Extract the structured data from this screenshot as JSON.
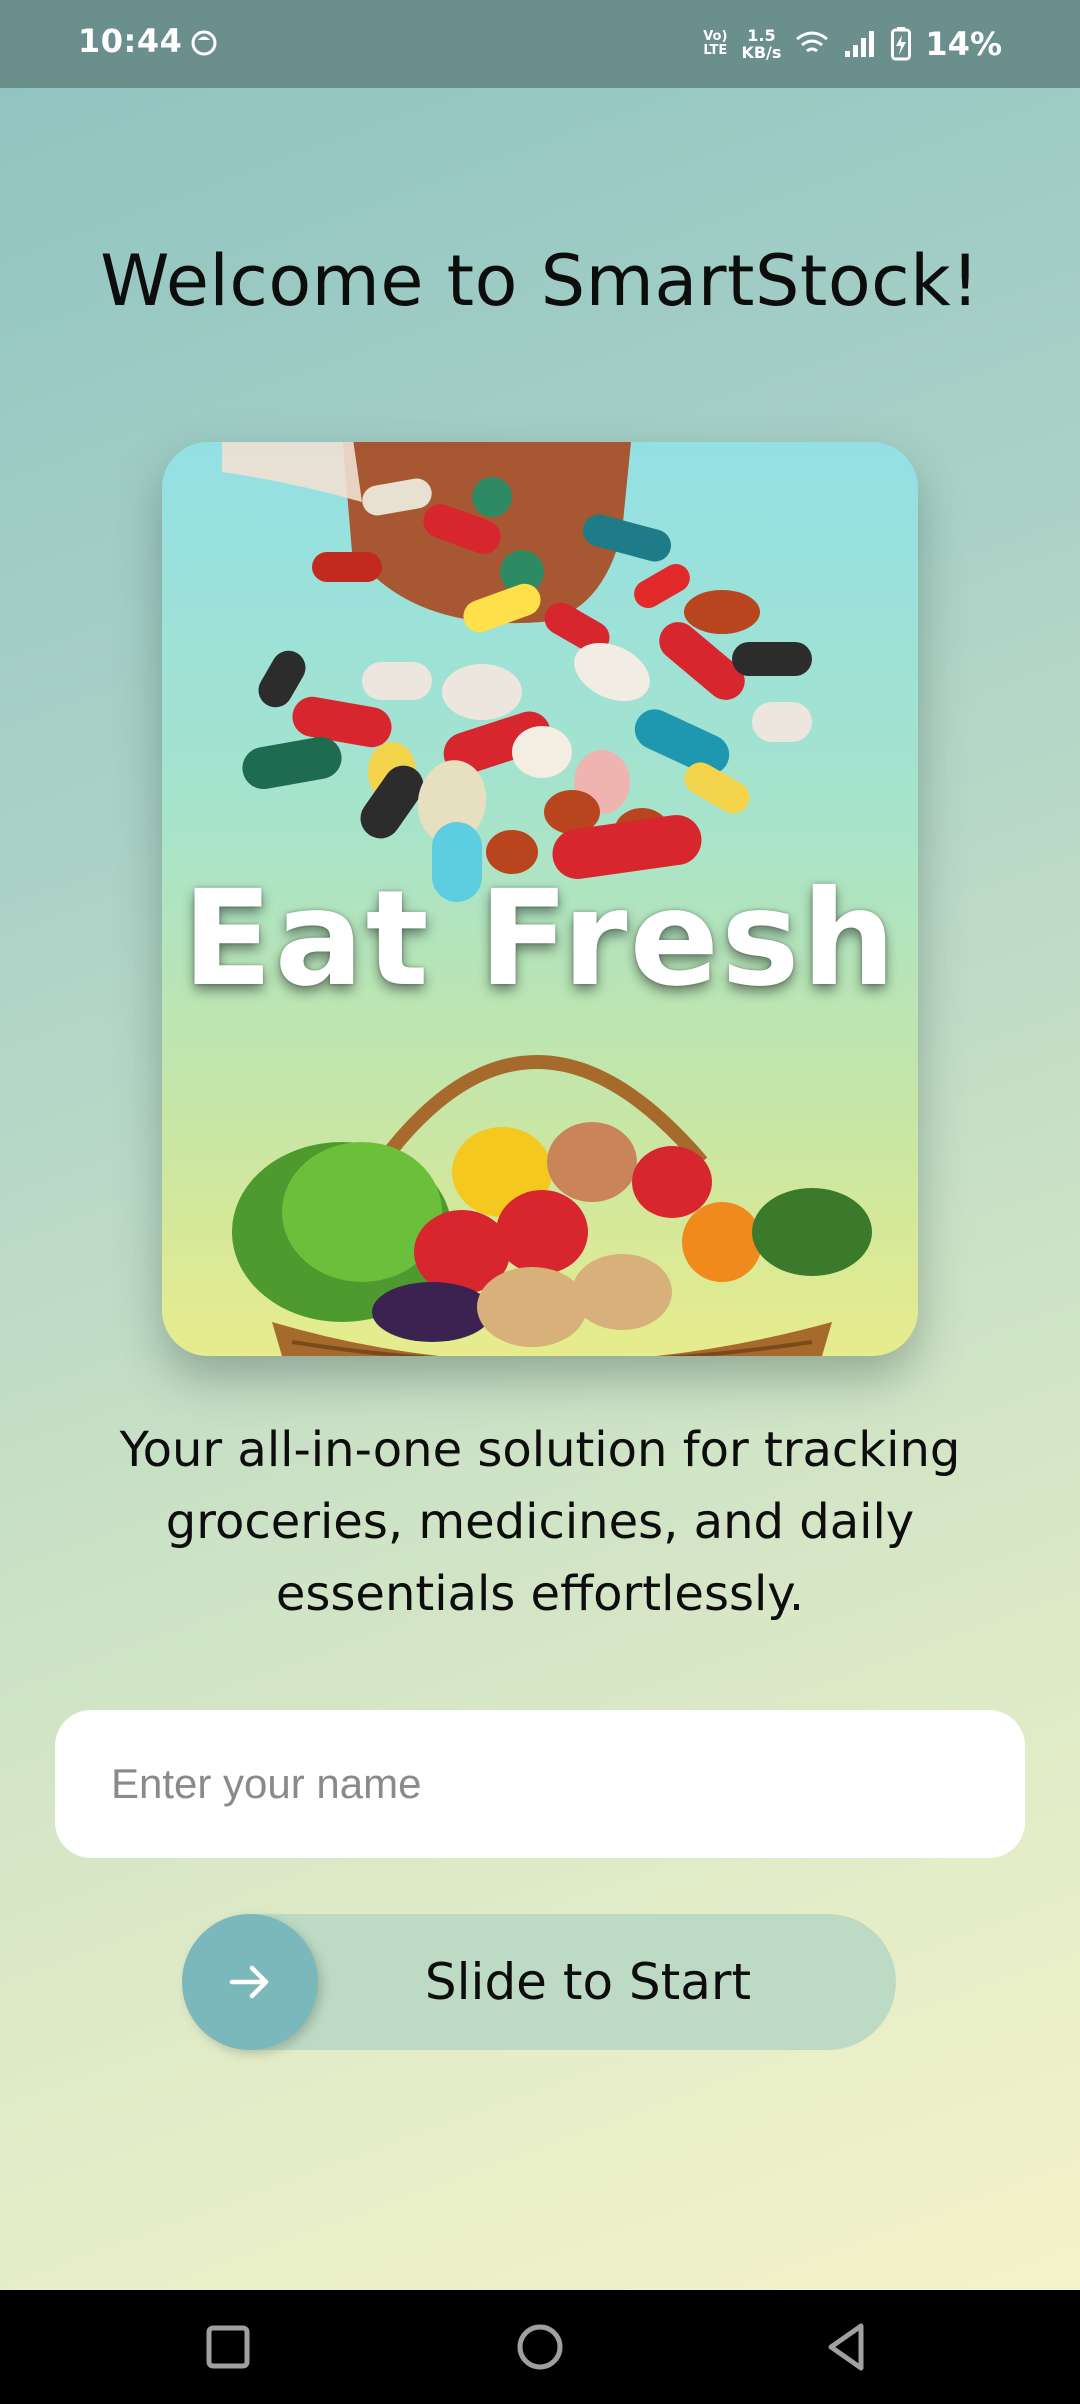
{
  "status_bar": {
    "time": "10:44",
    "network_type_top": "Vo)",
    "network_type_bottom": "LTE",
    "net_speed_value": "1.5",
    "net_speed_unit": "KB/s",
    "battery": "14%",
    "icons": [
      "app-notification-icon",
      "wifi-icon",
      "cell-signal-icon",
      "battery-charging-icon"
    ]
  },
  "main": {
    "title": "Welcome to SmartStock!",
    "hero_text": "Eat Fresh",
    "tagline": "Your all-in-one solution for tracking groceries, medicines, and daily essentials effortlessly.",
    "name_input": {
      "value": "",
      "placeholder": "Enter your name"
    },
    "slider": {
      "label": "Slide to Start",
      "icon": "arrow-right-icon",
      "progress": 0
    }
  },
  "nav_bar": {
    "buttons": [
      "recents-icon",
      "home-icon",
      "back-icon"
    ]
  },
  "colors": {
    "status_bar": "#6b8f8d",
    "slider_track": "#bddbc4",
    "slider_knob": "#7ab8bc",
    "text": "#0d0d0d",
    "input_background": "#ffffff"
  }
}
